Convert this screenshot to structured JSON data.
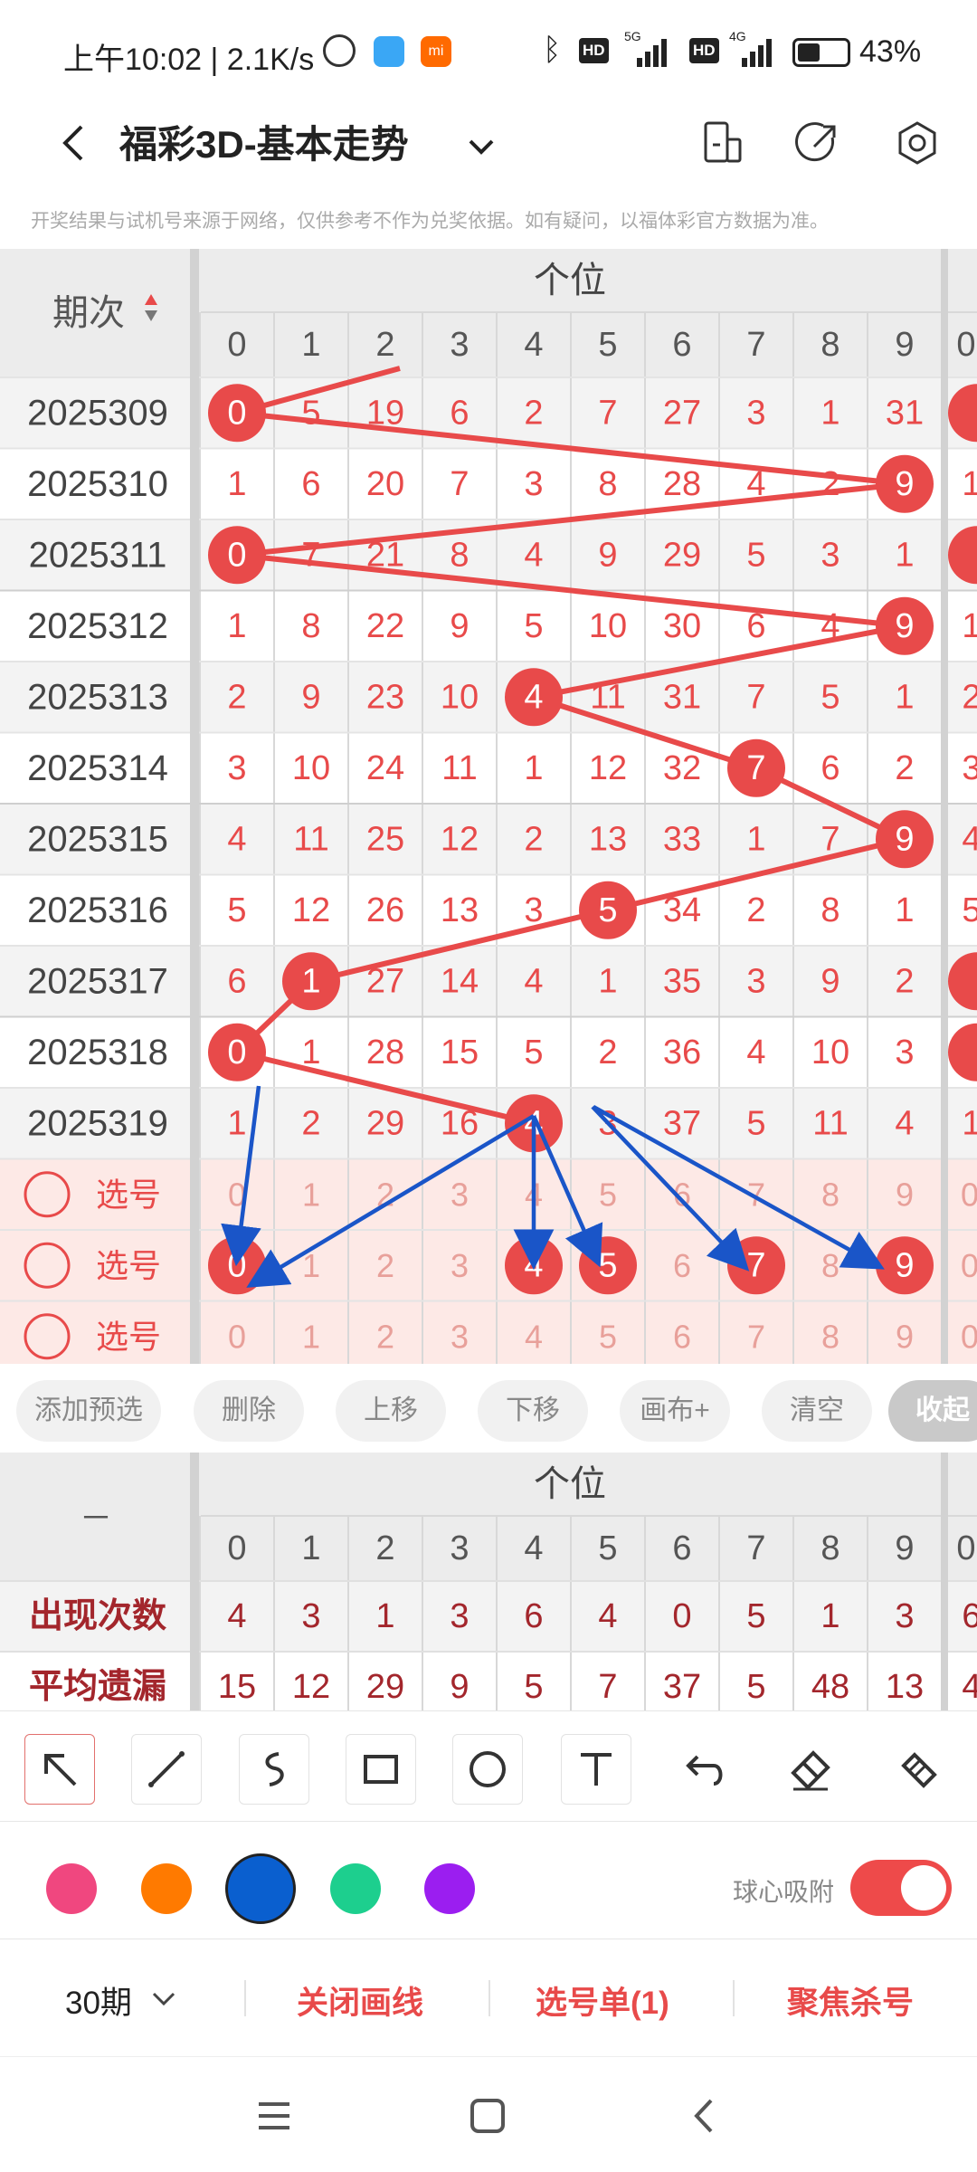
{
  "status": {
    "time": "上午10:02 | 2.1K/s",
    "battery": "43%",
    "net1": "5G",
    "net2": "4G",
    "hd": "HD"
  },
  "header": {
    "title": "福彩3D-基本走势"
  },
  "disclaimer": "开奖结果与试机号来源于网络，仅供参考不作为兑奖依据。如有疑问，以福体彩官方数据为准。",
  "grid": {
    "period_header": "期次",
    "position_header": "个位",
    "digits": [
      "0",
      "1",
      "2",
      "3",
      "4",
      "5",
      "6",
      "7",
      "8",
      "9"
    ],
    "next_digit": "0",
    "rows": [
      {
        "period": "2025309",
        "values": [
          "0",
          "5",
          "19",
          "6",
          "2",
          "7",
          "27",
          "3",
          "1",
          "31"
        ],
        "hit": 0,
        "next": "0"
      },
      {
        "period": "2025310",
        "values": [
          "1",
          "6",
          "20",
          "7",
          "3",
          "8",
          "28",
          "4",
          "2",
          "9"
        ],
        "hit": 9,
        "next": "1"
      },
      {
        "period": "2025311",
        "values": [
          "0",
          "7",
          "21",
          "8",
          "4",
          "9",
          "29",
          "5",
          "3",
          "1"
        ],
        "hit": 0,
        "next": "0"
      },
      {
        "period": "2025312",
        "values": [
          "1",
          "8",
          "22",
          "9",
          "5",
          "10",
          "30",
          "6",
          "4",
          "9"
        ],
        "hit": 9,
        "next": "1"
      },
      {
        "period": "2025313",
        "values": [
          "2",
          "9",
          "23",
          "10",
          "4",
          "11",
          "31",
          "7",
          "5",
          "1"
        ],
        "hit": 4,
        "next": "2"
      },
      {
        "period": "2025314",
        "values": [
          "3",
          "10",
          "24",
          "11",
          "1",
          "12",
          "32",
          "7",
          "6",
          "2"
        ],
        "hit": 7,
        "next": "3"
      },
      {
        "period": "2025315",
        "values": [
          "4",
          "11",
          "25",
          "12",
          "2",
          "13",
          "33",
          "1",
          "7",
          "9"
        ],
        "hit": 9,
        "next": "4"
      },
      {
        "period": "2025316",
        "values": [
          "5",
          "12",
          "26",
          "13",
          "3",
          "5",
          "34",
          "2",
          "8",
          "1"
        ],
        "hit": 5,
        "next": "5"
      },
      {
        "period": "2025317",
        "values": [
          "6",
          "1",
          "27",
          "14",
          "4",
          "1",
          "35",
          "3",
          "9",
          "2"
        ],
        "hit": 1,
        "next": "0"
      },
      {
        "period": "2025318",
        "values": [
          "0",
          "1",
          "28",
          "15",
          "5",
          "2",
          "36",
          "4",
          "10",
          "3"
        ],
        "hit": 0,
        "next": "0"
      },
      {
        "period": "2025319",
        "values": [
          "1",
          "2",
          "29",
          "16",
          "4",
          "3",
          "37",
          "5",
          "11",
          "4"
        ],
        "hit": 4,
        "next": "1"
      }
    ],
    "pick_label": "选号",
    "pick_rows": [
      {
        "selected": [],
        "next": "0"
      },
      {
        "selected": [
          0,
          4,
          5,
          7,
          9
        ],
        "next": "0"
      },
      {
        "selected": [],
        "next": "0"
      }
    ]
  },
  "actions": [
    "添加预选",
    "删除",
    "上移",
    "下移",
    "画布+",
    "清空",
    "收起"
  ],
  "stats": {
    "corner": "－",
    "position_header": "个位",
    "digits": [
      "0",
      "1",
      "2",
      "3",
      "4",
      "5",
      "6",
      "7",
      "8",
      "9"
    ],
    "next_digit": "0",
    "rows": [
      {
        "label": "出现次数",
        "values": [
          "4",
          "3",
          "1",
          "3",
          "6",
          "4",
          "0",
          "5",
          "1",
          "3"
        ],
        "next": "6"
      },
      {
        "label": "平均遗漏",
        "values": [
          "15",
          "12",
          "29",
          "9",
          "5",
          "7",
          "37",
          "5",
          "48",
          "13"
        ],
        "next": "4"
      }
    ]
  },
  "tools": [
    "pointer-arrow-icon",
    "line-icon",
    "freehand-icon",
    "rectangle-icon",
    "circle-icon",
    "text-icon",
    "undo-icon",
    "eraser-icon",
    "clear-canvas-icon"
  ],
  "palette": [
    "#f0477f",
    "#ff7a00",
    "#0a5fcf",
    "#1dcf8e",
    "#9b1ef0"
  ],
  "snap_label": "球心吸附",
  "snap_on": true,
  "colors": {
    "hit": "#e84a4a",
    "line": "#e84a4a",
    "arrow": "#1a55c8",
    "pick_bg": "#fde9e6"
  },
  "bottom": {
    "period_select": "30期",
    "close_lines": "关闭画线",
    "pick_list": "选号单(1)",
    "focus_kill": "聚焦杀号"
  }
}
